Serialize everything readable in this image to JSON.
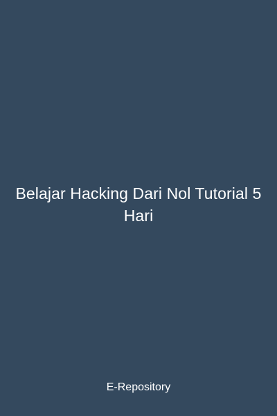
{
  "cover": {
    "background_color": "#34495e",
    "text_color": "#ffffff",
    "title": "Belajar Hacking Dari Nol Tutorial 5 Hari",
    "footer": "E-Repository"
  }
}
